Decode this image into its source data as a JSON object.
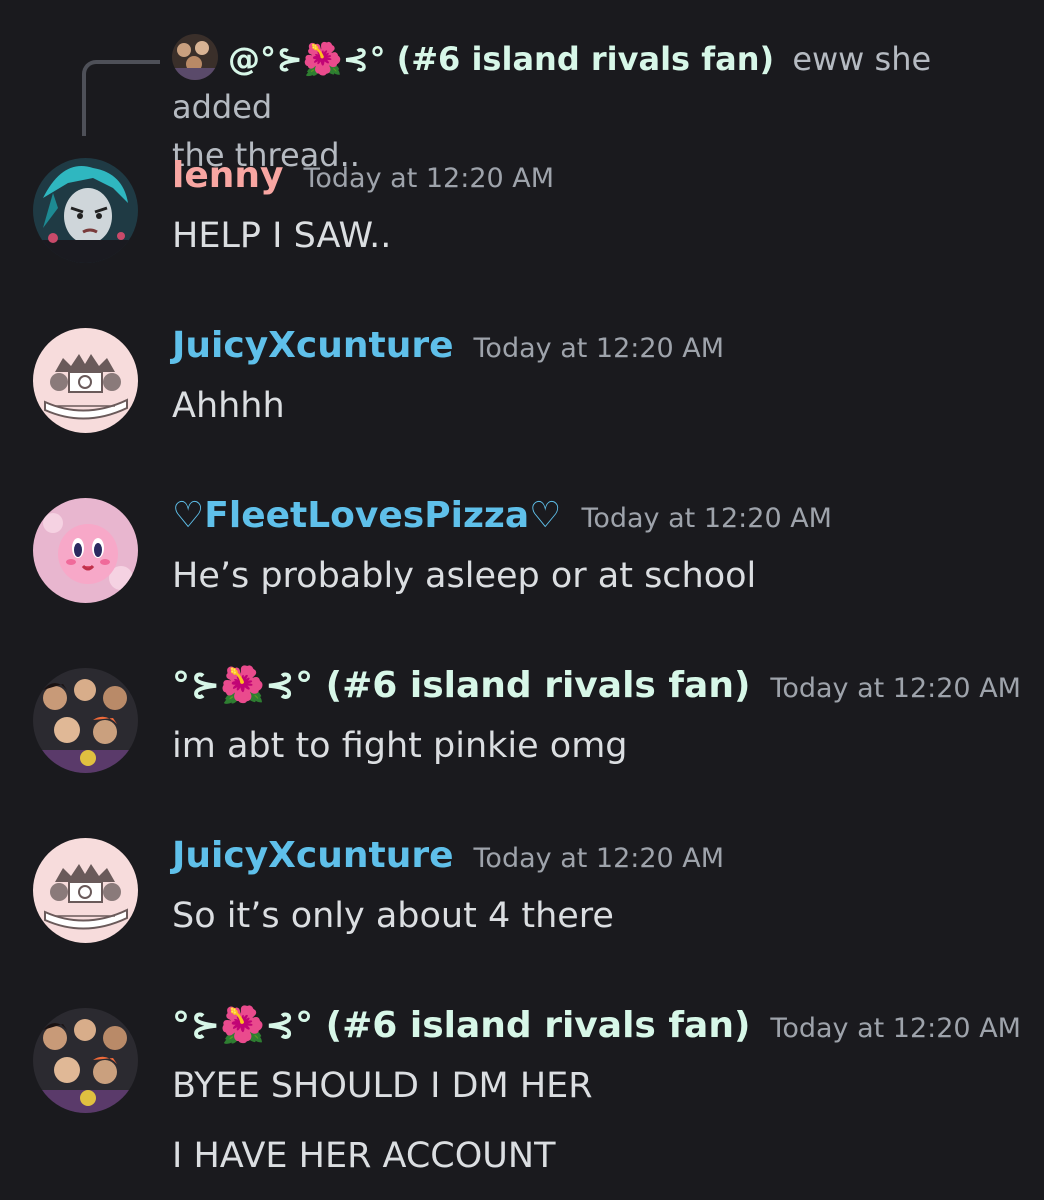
{
  "reply": {
    "author": "@°⊱🌺⊰° (#6 island rivals fan)",
    "text": "eww she added the thread..",
    "text_line1": "eww she added",
    "text_line2": "the thread.."
  },
  "messages": [
    {
      "author": "lenny",
      "author_color": "#f8a6a2",
      "timestamp": "Today at 12:20 AM",
      "lines": [
        "HELP I SAW.."
      ],
      "avatar": "anime-character-avatar"
    },
    {
      "author": "JuicyXcunture",
      "author_color": "#5fc0ea",
      "timestamp": "Today at 12:20 AM",
      "lines": [
        "Ahhhh"
      ],
      "avatar": "juicy-couture-logo-avatar"
    },
    {
      "author": "♡FleetLovesPizza♡",
      "author_color": "#5fc0ea",
      "timestamp": "Today at 12:20 AM",
      "lines": [
        "He’s probably asleep or at school"
      ],
      "avatar": "kirby-avatar"
    },
    {
      "author": "°⊱🌺⊰° (#6 island rivals fan)",
      "author_color": "#d7f7e8",
      "timestamp": "Today at 12:20 AM",
      "lines": [
        "im abt to fight pinkie omg"
      ],
      "avatar": "group-photo-avatar"
    },
    {
      "author": "JuicyXcunture",
      "author_color": "#5fc0ea",
      "timestamp": "Today at 12:20 AM",
      "lines": [
        "So it’s only about 4 there"
      ],
      "avatar": "juicy-couture-logo-avatar"
    },
    {
      "author": "°⊱🌺⊰° (#6 island rivals fan)",
      "author_color": "#d7f7e8",
      "timestamp": "Today at 12:20 AM",
      "lines": [
        "BYEE SHOULD I DM HER",
        "I HAVE HER ACCOUNT"
      ],
      "avatar": "group-photo-avatar"
    }
  ]
}
